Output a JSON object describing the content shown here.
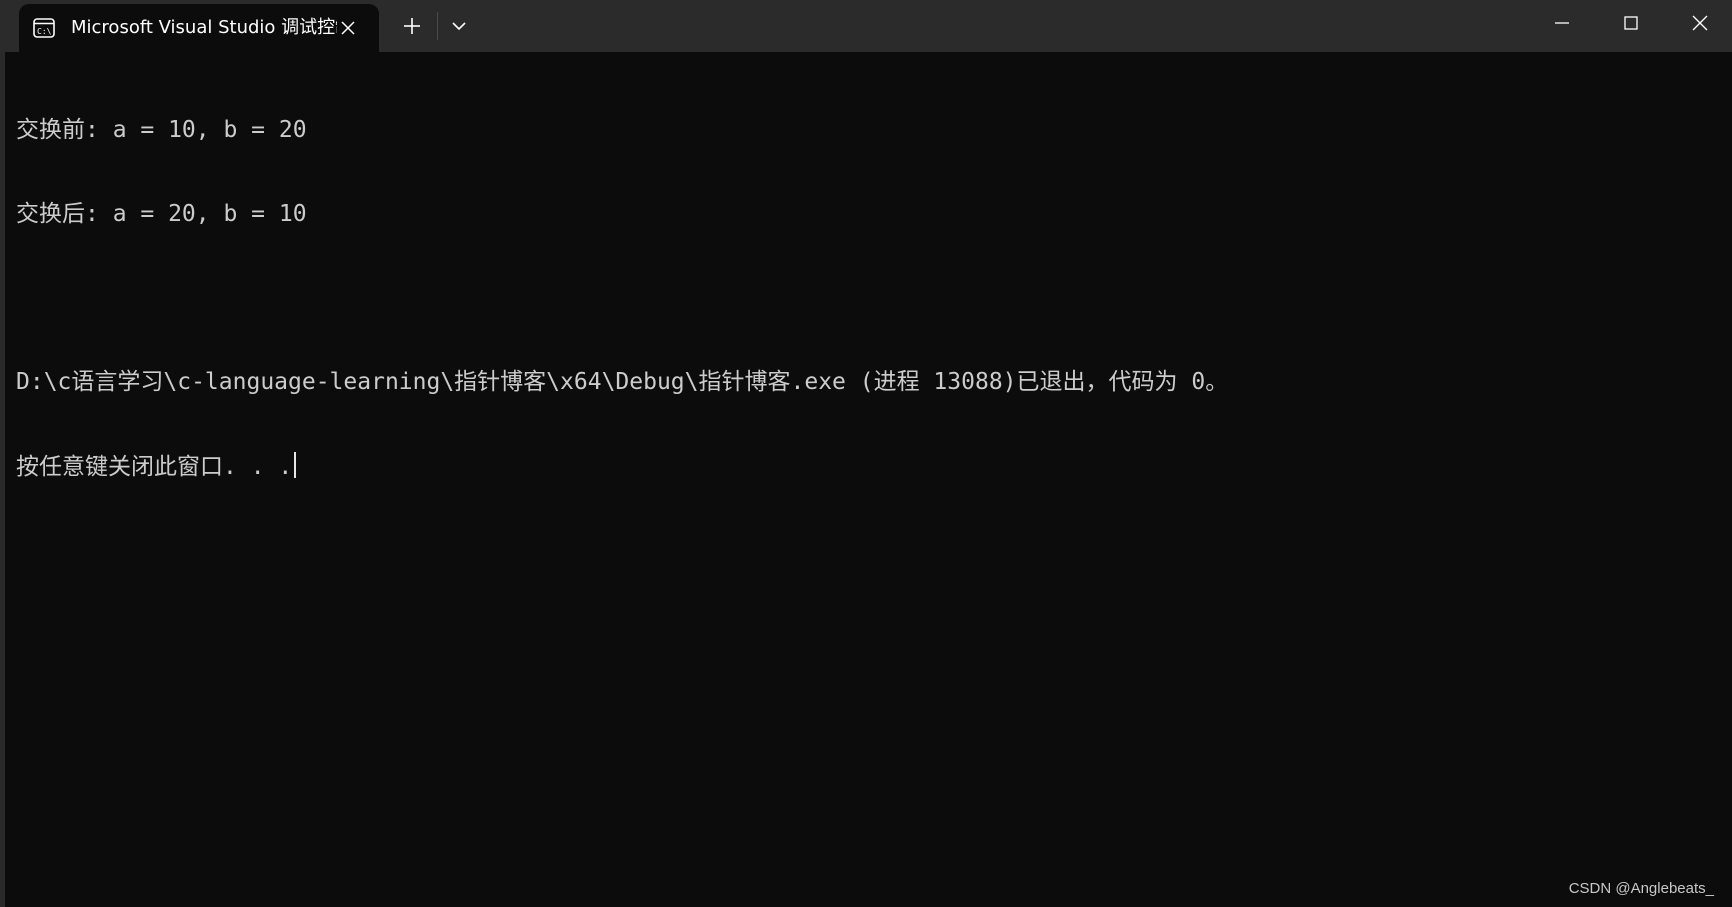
{
  "tab": {
    "title": "Microsoft Visual Studio 调试控制台",
    "icon": "terminal-icon"
  },
  "titlebar": {
    "new_tab_icon": "plus-icon",
    "dropdown_icon": "chevron-down-icon",
    "minimize_icon": "minimize-icon",
    "maximize_icon": "maximize-icon",
    "close_icon": "close-icon"
  },
  "terminal": {
    "lines": [
      "交换前: a = 10, b = 20",
      "交换后: a = 20, b = 10",
      "",
      "D:\\c语言学习\\c-language-learning\\指针博客\\x64\\Debug\\指针博客.exe (进程 13088)已退出，代码为 0。",
      "按任意键关闭此窗口. . ."
    ]
  },
  "watermark": "CSDN @Anglebeats_",
  "colors": {
    "background": "#0c0c0c",
    "titlebar": "#2b2b2b",
    "text": "#cccccc"
  }
}
